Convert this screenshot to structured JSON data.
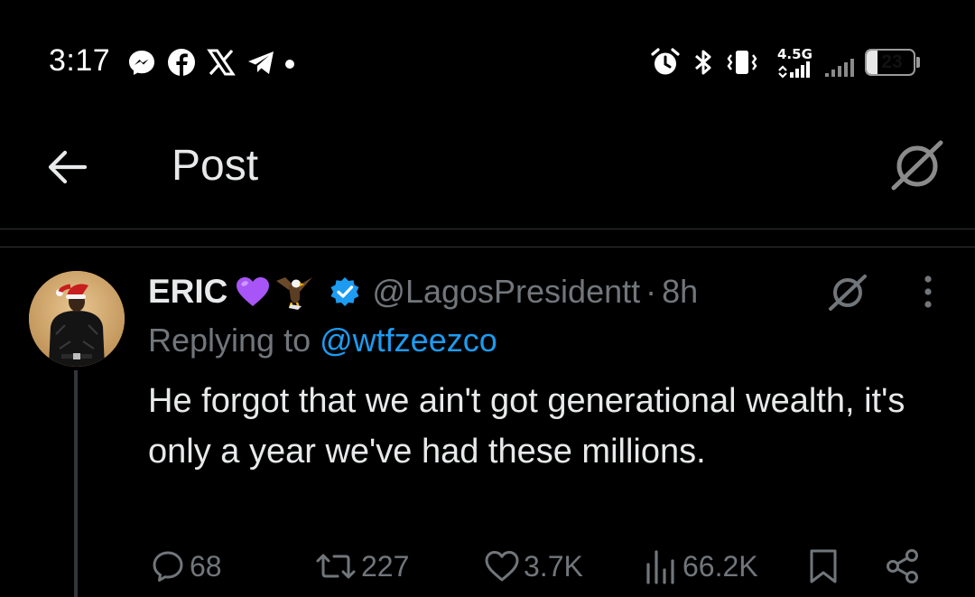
{
  "status_bar": {
    "time": "3:17",
    "network_label": "4.5G",
    "battery_level": "23",
    "battery_fraction": 0.23,
    "icons": [
      "messenger-icon",
      "facebook-icon",
      "x-icon",
      "telegram-icon",
      "notification-dot",
      "alarm-icon",
      "bluetooth-icon",
      "vibrate-icon",
      "mobile-data-icon",
      "signal-icon",
      "signal-weak-icon",
      "battery-icon"
    ]
  },
  "header": {
    "title": "Post",
    "back_icon": "arrow-left-icon",
    "grok_icon": "grok-icon"
  },
  "tweet": {
    "display_name": "ERIC",
    "name_emojis": [
      "purple-heart-emoji",
      "eagle-emoji"
    ],
    "verified": true,
    "handle": "@LagosPresidentt",
    "separator": "·",
    "time_ago": "8h",
    "reply_prefix": "Replying to",
    "reply_to": "@wtfzeezco",
    "text": "He forgot that we ain't got generational wealth, it's only a year we've had these millions.",
    "actions": {
      "replies": "68",
      "reposts": "227",
      "likes": "3.7K",
      "views": "66.2K"
    }
  },
  "colors": {
    "background": "#000000",
    "text": "#e7e9ea",
    "secondary": "#71767b",
    "accent": "#1d9bf0",
    "divider": "#2f3336"
  }
}
